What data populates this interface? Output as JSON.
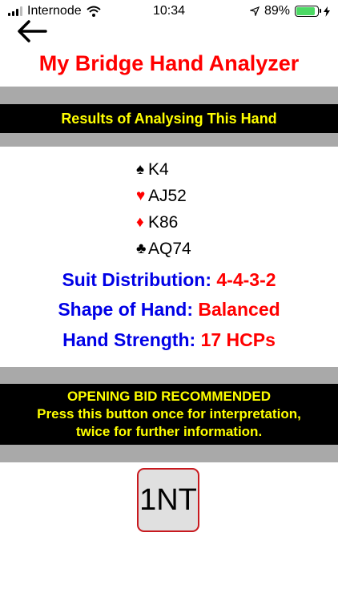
{
  "status_bar": {
    "carrier": "Internode",
    "time": "10:34",
    "battery_percent": "89%",
    "battery_level": 0.89,
    "icons": [
      "signal-icon",
      "wifi-icon",
      "location-icon",
      "battery-icon",
      "charging-icon"
    ]
  },
  "nav": {
    "back_icon": "arrow-left-icon"
  },
  "app_title": "My Bridge Hand Analyzer",
  "results_header": "Results of Analysing This Hand",
  "hand": [
    {
      "suit": "spades",
      "symbol": "♠",
      "color": "#000000",
      "cards": "K4"
    },
    {
      "suit": "hearts",
      "symbol": "♥",
      "color": "#ff0000",
      "cards": "AJ52"
    },
    {
      "suit": "diamonds",
      "symbol": "♦",
      "color": "#ff0000",
      "cards": "K86"
    },
    {
      "suit": "clubs",
      "symbol": "♣",
      "color": "#000000",
      "cards": "AQ74"
    }
  ],
  "analysis": {
    "distribution_label": "Suit Distribution:",
    "distribution_value": "4-4-3-2",
    "shape_label": "Shape of Hand:",
    "shape_value": "Balanced",
    "strength_label": "Hand Strength:",
    "strength_value": "17 HCPs"
  },
  "recommendation": {
    "line1": "OPENING BID RECOMMENDED",
    "line2": "Press this button once for interpretation,",
    "line3": "twice for further information."
  },
  "bid_button_label": "1NT",
  "colors": {
    "title": "#ff0000",
    "label": "#0000e6",
    "value": "#ff0000",
    "band_text": "#ffff00",
    "band_bg": "#000000",
    "gray_band": "#a9a9a9",
    "button_border": "#c8191e"
  }
}
